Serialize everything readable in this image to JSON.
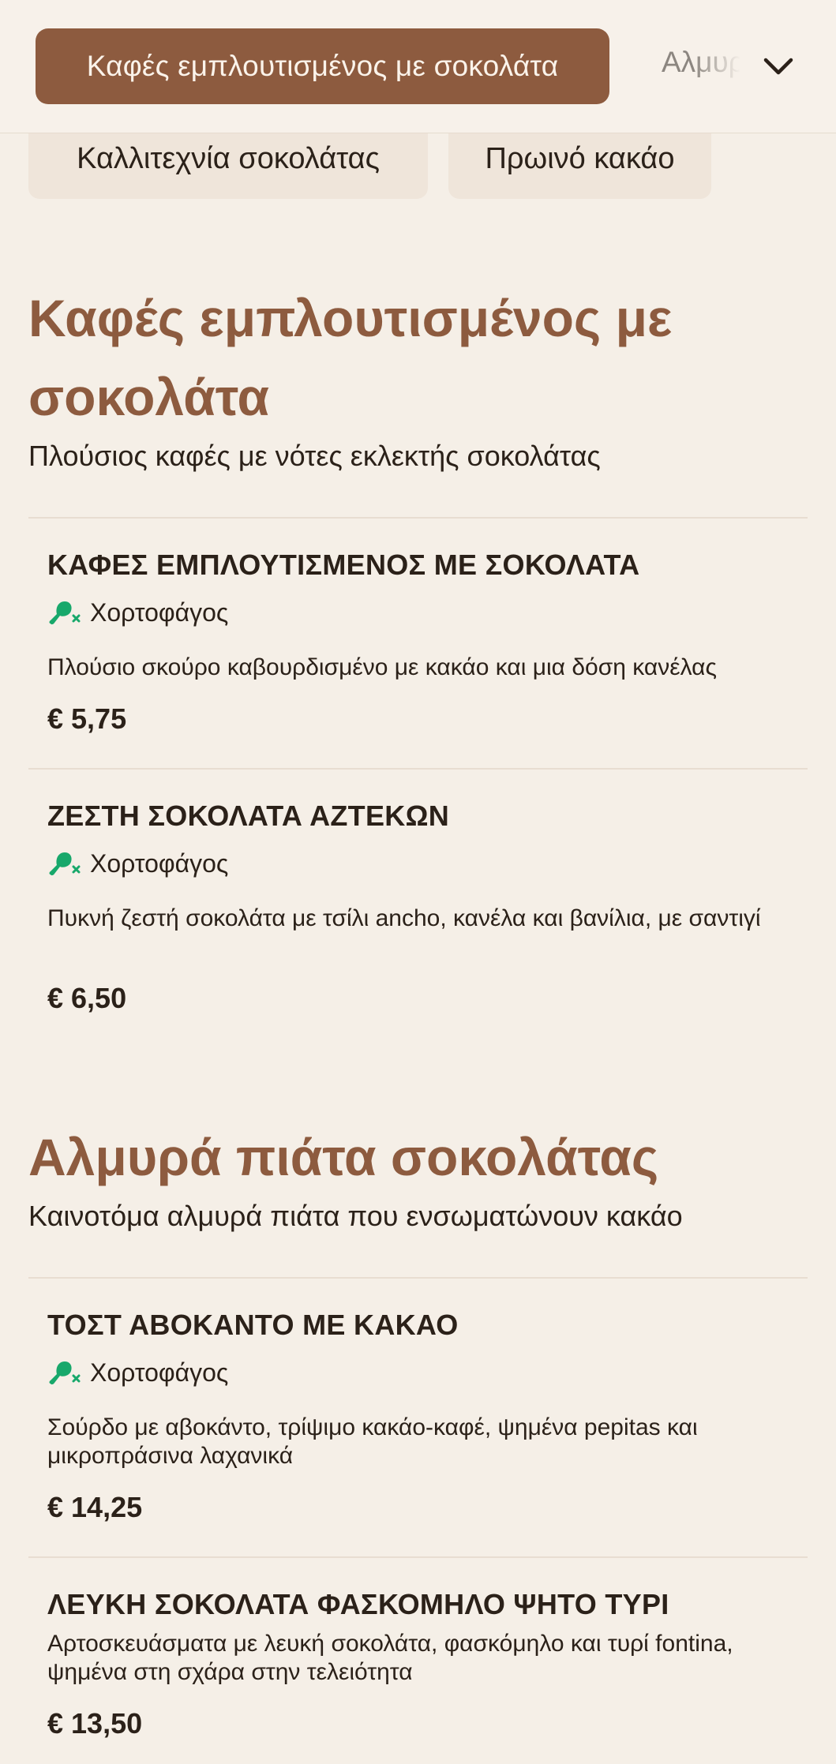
{
  "tabs": {
    "active": "Καφές εμπλουτισμένος με σοκολάτα",
    "next": "Αλμυρά πιάτα σοκολάτας"
  },
  "chips": [
    "Καλλιτεχνία σοκολάτας",
    "Πρωινό κακάο"
  ],
  "sections": [
    {
      "title_line1": "Καφές εμπλουτισμένος με",
      "title_line2": "σοκολάτα",
      "subtitle": "Πλούσιος καφές με νότες εκλεκτής σοκολάτας",
      "items": [
        {
          "name": "ΚΑΦΕΣ ΕΜΠΛΟΥΤΙΣΜΕΝΟΣ ΜΕ ΣΟΚΟΛΑΤΑ",
          "tag": "Χορτοφάγος",
          "description": "Πλούσιο σκούρο καβουρδισμένο με κακάο και μια δόση κανέλας",
          "price": "€ 5,75"
        },
        {
          "name": "ΖΕΣΤΗ ΣΟΚΟΛΑΤΑ ΑΖΤΕΚΩΝ",
          "tag": "Χορτοφάγος",
          "description": "Πυκνή ζεστή σοκολάτα με τσίλι ancho, κανέλα και βανίλια, με σαντιγί",
          "price": "€ 6,50"
        }
      ]
    },
    {
      "title_line1": "Αλμυρά πιάτα σοκολάτας",
      "subtitle": "Καινοτόμα αλμυρά πιάτα που ενσωματώνουν κακάο",
      "items": [
        {
          "name": "ΤΟΣΤ ΑΒΟΚΑΝΤΟ ΜΕ ΚΑΚΑΟ",
          "tag": "Χορτοφάγος",
          "description": "Σούρδο με αβοκάντο, τρίψιμο κακάο-καφέ, ψημένα pepitas και μικροπράσινα λαχανικά",
          "price": "€ 14,25"
        },
        {
          "name": "ΛΕΥΚΗ ΣΟΚΟΛΑΤΑ ΦΑΣΚΟΜΗΛΟ ΨΗΤΟ ΤΥΡΙ",
          "description": "Αρτοσκευάσματα με λευκή σοκολάτα, φασκόμηλο και τυρί fontina, ψημένα στη σχάρα στην τελειότητα",
          "price": "€ 13,50"
        }
      ]
    }
  ],
  "icons": {
    "veg_tag": "vegetarian-drumstick-crossed-icon",
    "dropdown": "chevron-down-icon"
  },
  "colors": {
    "accent": "#8d5b3f",
    "background": "#f5efe7",
    "veg_green": "#18a86b"
  }
}
